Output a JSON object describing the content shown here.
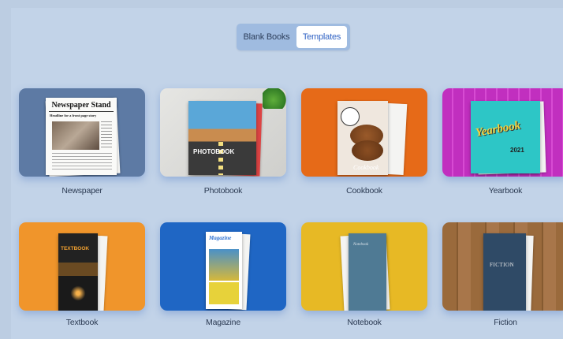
{
  "toggle": {
    "blank_label": "Blank Books",
    "templates_label": "Templates",
    "selected": "Templates"
  },
  "templates": [
    {
      "label": "Newspaper",
      "cover_title": "Newspaper Stand",
      "cover_headline": "Headline for a front page story",
      "color": "#5d7aa4"
    },
    {
      "label": "Photobook",
      "cover_title": "PHOTOBOOK",
      "color": "#d9d9d6"
    },
    {
      "label": "Cookbook",
      "cover_title": "Cookbook",
      "color": "#e66a18"
    },
    {
      "label": "Yearbook",
      "cover_title": "Yearbook",
      "cover_year": "2021",
      "color": "#c12fbf"
    },
    {
      "label": "Textbook",
      "cover_title": "TEXTBOOK",
      "color": "#f0952b"
    },
    {
      "label": "Magazine",
      "cover_title": "Magazine",
      "color": "#1f66c4"
    },
    {
      "label": "Notebook",
      "cover_title": "Notebook",
      "color": "#e7b925"
    },
    {
      "label": "Fiction",
      "cover_title": "FICTION",
      "color": "#9a6a3c"
    }
  ]
}
